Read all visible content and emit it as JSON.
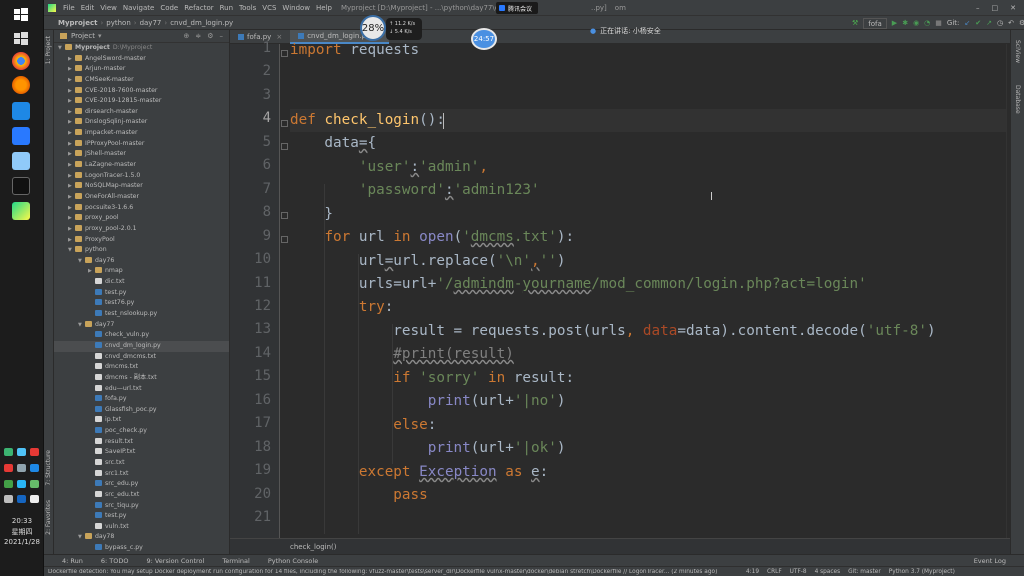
{
  "taskbar": {
    "clock_time": "20:33",
    "clock_day": "星期四",
    "clock_date": "2021/1/28"
  },
  "titlebar": {
    "menus": [
      "File",
      "Edit",
      "View",
      "Navigate",
      "Code",
      "Refactor",
      "Run",
      "Tools",
      "VCS",
      "Window",
      "Help"
    ],
    "title": "Myproject [D:\\Myproject] - ...\\python\\day77\\cnvd_dm",
    "title_suffix": "..py]",
    "title_tail": "om"
  },
  "navbar": {
    "crumbs": [
      "Myproject",
      "python",
      "day77",
      "cnvd_dm_login.py"
    ]
  },
  "overlay": {
    "speed_percent": "28%",
    "upload": "↑ 11.2 K/s",
    "download": "↓ 5.4 K/s",
    "timer": "24:57",
    "meeting_chip": "腾讯会议",
    "speaking_label": "正在讲话: 小杨安全"
  },
  "run_toolbar": {
    "config": "fofa",
    "git_label": "Git:"
  },
  "tool_strip": {
    "left_top": "1: Project",
    "left_mid": "7: Structure",
    "left_bottom": "2: Favorites",
    "right_top": "SciView",
    "right_bottom": "Database"
  },
  "project": {
    "header": "Project",
    "tree": [
      {
        "indent": 0,
        "arrow": "▼",
        "icon": "folder",
        "label": "Myproject",
        "path": "D:\\Myproject"
      },
      {
        "indent": 1,
        "arrow": "▶",
        "icon": "folder",
        "label": "AngelSword-master"
      },
      {
        "indent": 1,
        "arrow": "▶",
        "icon": "folder",
        "label": "Arjun-master"
      },
      {
        "indent": 1,
        "arrow": "▶",
        "icon": "folder",
        "label": "CMSeeK-master"
      },
      {
        "indent": 1,
        "arrow": "▶",
        "icon": "folder",
        "label": "CVE-2018-7600-master"
      },
      {
        "indent": 1,
        "arrow": "▶",
        "icon": "folder",
        "label": "CVE-2019-12815-master"
      },
      {
        "indent": 1,
        "arrow": "▶",
        "icon": "folder",
        "label": "dirsearch-master"
      },
      {
        "indent": 1,
        "arrow": "▶",
        "icon": "folder",
        "label": "DnslogSqlinj-master"
      },
      {
        "indent": 1,
        "arrow": "▶",
        "icon": "folder",
        "label": "impacket-master"
      },
      {
        "indent": 1,
        "arrow": "▶",
        "icon": "folder",
        "label": "IPProxyPool-master"
      },
      {
        "indent": 1,
        "arrow": "▶",
        "icon": "folder",
        "label": "JShell-master"
      },
      {
        "indent": 1,
        "arrow": "▶",
        "icon": "folder",
        "label": "LaZagne-master"
      },
      {
        "indent": 1,
        "arrow": "▶",
        "icon": "folder",
        "label": "LogonTracer-1.5.0"
      },
      {
        "indent": 1,
        "arrow": "▶",
        "icon": "folder",
        "label": "NoSQLMap-master"
      },
      {
        "indent": 1,
        "arrow": "▶",
        "icon": "folder",
        "label": "OneForAll-master"
      },
      {
        "indent": 1,
        "arrow": "▶",
        "icon": "folder",
        "label": "pocsuite3-1.6.6"
      },
      {
        "indent": 1,
        "arrow": "▶",
        "icon": "folder",
        "label": "proxy_pool"
      },
      {
        "indent": 1,
        "arrow": "▶",
        "icon": "folder",
        "label": "proxy_pool-2.0.1"
      },
      {
        "indent": 1,
        "arrow": "▶",
        "icon": "folder",
        "label": "ProxyPool"
      },
      {
        "indent": 1,
        "arrow": "▼",
        "icon": "folder",
        "label": "python"
      },
      {
        "indent": 2,
        "arrow": "▼",
        "icon": "folder",
        "label": "day76"
      },
      {
        "indent": 3,
        "arrow": "▶",
        "icon": "folder",
        "label": "nmap"
      },
      {
        "indent": 3,
        "arrow": "",
        "icon": "txt",
        "label": "dic.txt"
      },
      {
        "indent": 3,
        "arrow": "",
        "icon": "py",
        "label": "test.py"
      },
      {
        "indent": 3,
        "arrow": "",
        "icon": "py",
        "label": "test76.py"
      },
      {
        "indent": 3,
        "arrow": "",
        "icon": "py",
        "label": "test_nslookup.py"
      },
      {
        "indent": 2,
        "arrow": "▼",
        "icon": "folder",
        "label": "day77"
      },
      {
        "indent": 3,
        "arrow": "",
        "icon": "py",
        "label": "check_vuln.py"
      },
      {
        "indent": 3,
        "arrow": "",
        "icon": "py",
        "label": "cnvd_dm_login.py"
      },
      {
        "indent": 3,
        "arrow": "",
        "icon": "txt",
        "label": "cnvd_dmcms.txt"
      },
      {
        "indent": 3,
        "arrow": "",
        "icon": "txt",
        "label": "dmcms.txt"
      },
      {
        "indent": 3,
        "arrow": "",
        "icon": "txt",
        "label": "dmcms - 副本.txt"
      },
      {
        "indent": 3,
        "arrow": "",
        "icon": "txt",
        "label": "edu—url.txt"
      },
      {
        "indent": 3,
        "arrow": "",
        "icon": "py",
        "label": "fofa.py"
      },
      {
        "indent": 3,
        "arrow": "",
        "icon": "py",
        "label": "Glassfish_poc.py"
      },
      {
        "indent": 3,
        "arrow": "",
        "icon": "txt",
        "label": "ip.txt"
      },
      {
        "indent": 3,
        "arrow": "",
        "icon": "py",
        "label": "poc_check.py"
      },
      {
        "indent": 3,
        "arrow": "",
        "icon": "txt",
        "label": "result.txt"
      },
      {
        "indent": 3,
        "arrow": "",
        "icon": "txt",
        "label": "SaveIP.txt"
      },
      {
        "indent": 3,
        "arrow": "",
        "icon": "txt",
        "label": "src.txt"
      },
      {
        "indent": 3,
        "arrow": "",
        "icon": "txt",
        "label": "src1.txt"
      },
      {
        "indent": 3,
        "arrow": "",
        "icon": "py",
        "label": "src_edu.py"
      },
      {
        "indent": 3,
        "arrow": "",
        "icon": "txt",
        "label": "src_edu.txt"
      },
      {
        "indent": 3,
        "arrow": "",
        "icon": "py",
        "label": "src_tiqu.py"
      },
      {
        "indent": 3,
        "arrow": "",
        "icon": "py",
        "label": "test.py"
      },
      {
        "indent": 3,
        "arrow": "",
        "icon": "txt",
        "label": "vuln.txt"
      },
      {
        "indent": 2,
        "arrow": "▼",
        "icon": "folder",
        "label": "day78"
      },
      {
        "indent": 3,
        "arrow": "",
        "icon": "py",
        "label": "bypass_c.py"
      }
    ]
  },
  "tabs": [
    {
      "label": "fofa.py",
      "active": false
    },
    {
      "label": "cnvd_dm_login.py",
      "active": true
    }
  ],
  "editor": {
    "line_numbers": [
      "1",
      "2",
      "3",
      "4",
      "5",
      "6",
      "7",
      "8",
      "9",
      "10",
      "11",
      "12",
      "13",
      "14",
      "15",
      "16",
      "17",
      "18",
      "19",
      "20",
      "21"
    ],
    "current_line": 4
  },
  "code_crumb": "check_login()",
  "tool_tabs": [
    "4: Run",
    "6: TODO",
    "9: Version Control",
    "Terminal",
    "Python Console"
  ],
  "event_log": "Event Log",
  "status": {
    "message": "Dockerfile detection: You may setup Docker deployment run configuration for 14 files, including the following: vfuzz-master\\tests\\server_dir\\Dockerfile vulnx-master\\docker\\debian stretch\\Dockerfile // LogonTracer... (2 minutes ago)",
    "position": "4:19",
    "line_sep": "CRLF",
    "encoding": "UTF-8",
    "indent": "4 spaces",
    "git": "Git: master",
    "interpreter": "Python 3.7 (Myproject)"
  },
  "colors": {
    "keyword": "#cc7832",
    "function": "#ffc66d",
    "string": "#6a8759",
    "comment": "#808080",
    "builtin": "#8888c6",
    "named_arg": "#aa4926",
    "text": "#a9b7c6",
    "accent": "#4a88c7"
  }
}
